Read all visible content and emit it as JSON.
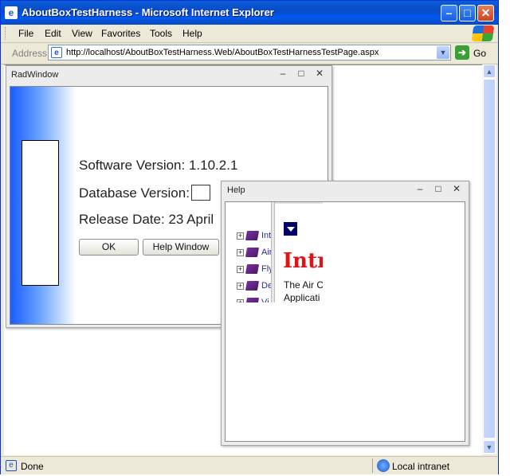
{
  "window": {
    "title": "AboutBoxTestHarness - Microsoft Internet Explorer"
  },
  "menu": [
    "File",
    "Edit",
    "View",
    "Favorites",
    "Tools",
    "Help"
  ],
  "address": {
    "label": "Address",
    "url": "http://localhost/AboutBoxTestHarness.Web/AboutBoxTestHarnessTestPage.aspx",
    "go_label": "Go"
  },
  "radwindow": {
    "title": "RadWindow",
    "software_version": "Software Version: 1.10.2.1",
    "database_version": "Database Version:",
    "release_date": "Release Date: 23 April",
    "ok_label": "OK",
    "help_label": "Help Window"
  },
  "help": {
    "title": "Help",
    "toc": [
      "Int",
      "Air",
      "Fly",
      "De",
      "Vi"
    ],
    "heading": "Intr",
    "text_line1": "The Air C",
    "text_line2": "Applicati"
  },
  "status": {
    "text": "Done",
    "zone": "Local intranet"
  },
  "colors": {
    "titlebar": "#0a49c7",
    "accent": "#1a5cff",
    "help_heading": "#e01414",
    "dropdown": "#000066"
  }
}
